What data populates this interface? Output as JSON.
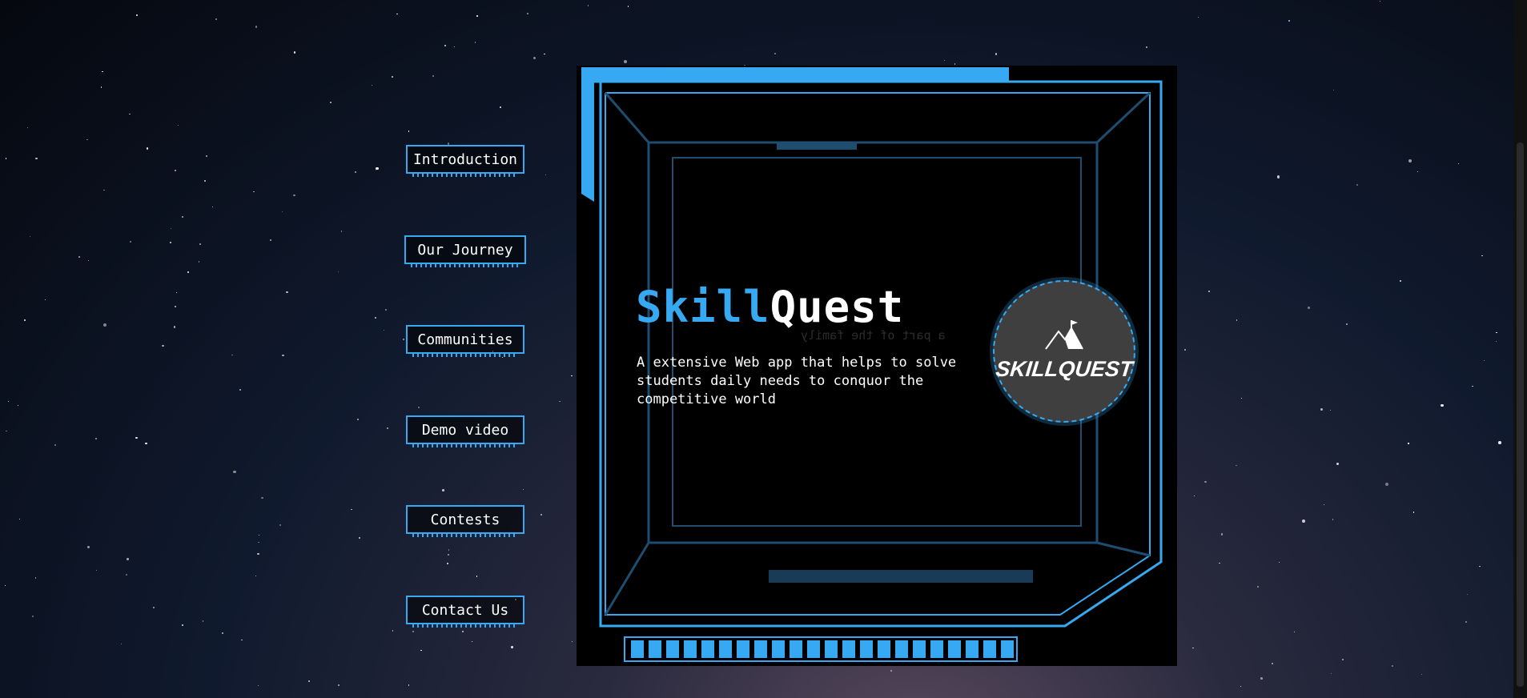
{
  "nav": {
    "items": [
      {
        "label": "Introduction"
      },
      {
        "label": "Our Journey"
      },
      {
        "label": "Communities"
      },
      {
        "label": "Demo video"
      },
      {
        "label": "Contests"
      },
      {
        "label": "Contact Us"
      }
    ]
  },
  "hero": {
    "title_part1": "Skill",
    "title_part2": "Quest",
    "description": "A extensive Web app that helps to solve students daily needs to conquor the competitive world"
  },
  "logo": {
    "wordmark": "SKILLQUEST",
    "icon": "mountain-flag-icon"
  },
  "colors": {
    "accent": "#36a9f2",
    "background": "#05080f",
    "frame": "#000000",
    "logo_bg": "#3f3f3f"
  }
}
